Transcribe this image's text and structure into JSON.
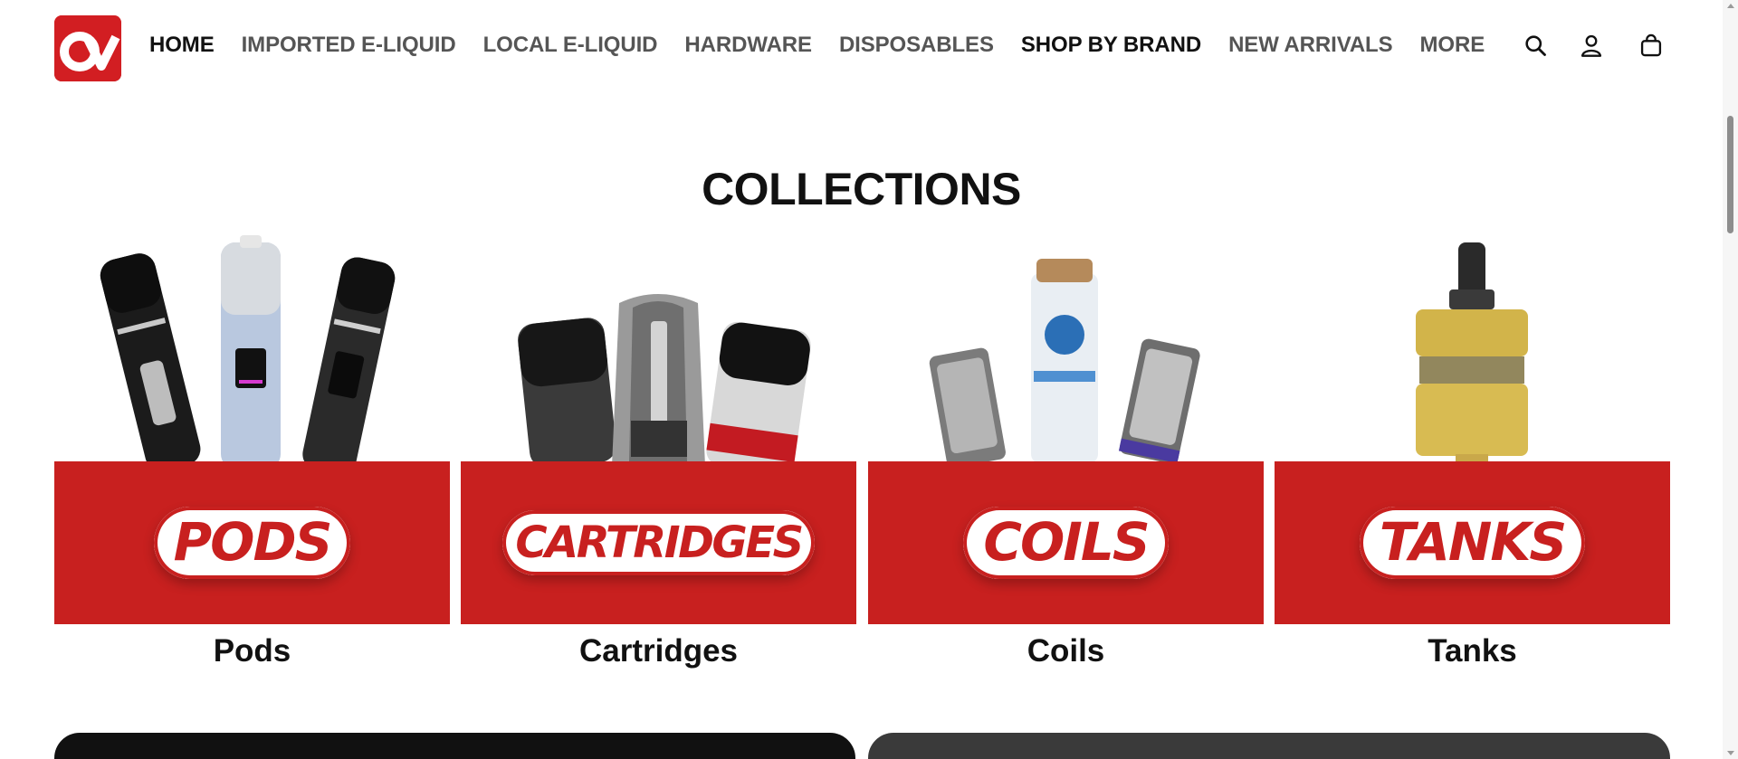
{
  "brand": {
    "logo_name": "brand-logo",
    "color": "#d8201f"
  },
  "nav": {
    "items": [
      {
        "label": "HOME"
      },
      {
        "label": "IMPORTED E-LIQUID"
      },
      {
        "label": "LOCAL E-LIQUID"
      },
      {
        "label": "HARDWARE"
      },
      {
        "label": "DISPOSABLES"
      },
      {
        "label": "SHOP BY BRAND"
      },
      {
        "label": "NEW ARRIVALS"
      },
      {
        "label": "MORE"
      }
    ]
  },
  "header_icons": [
    "search-icon",
    "account-icon",
    "cart-icon"
  ],
  "section": {
    "title": "COLLECTIONS"
  },
  "collections": [
    {
      "banner": "PODS",
      "label": "Pods"
    },
    {
      "banner": "CARTRIDGES",
      "label": "Cartridges"
    },
    {
      "banner": "COILS",
      "label": "Coils"
    },
    {
      "banner": "TANKS",
      "label": "Tanks"
    }
  ],
  "colors": {
    "accent": "#c8201f",
    "text": "#111111",
    "nav_muted": "#555555"
  }
}
